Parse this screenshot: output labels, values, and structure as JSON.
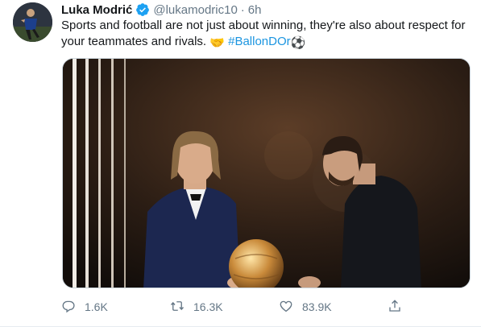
{
  "tweet": {
    "author_name": "Luka Modrić",
    "handle": "@lukamodric10",
    "separator": "·",
    "time": "6h",
    "text_main": "Sports and football are not just about winning, they're also about respect for your teammates and rivals.",
    "hashtag": "#BallonDOr",
    "emoji_handshake": "🤝",
    "emoji_ball": "⚽",
    "accent_color": "#1da1f2",
    "verified_icon": "verified-badge-icon"
  },
  "actions": {
    "reply_count": "1.6K",
    "retweet_count": "16.3K",
    "like_count": "83.9K",
    "reply_icon": "reply-icon",
    "retweet_icon": "retweet-icon",
    "like_icon": "heart-icon",
    "share_icon": "share-icon"
  }
}
